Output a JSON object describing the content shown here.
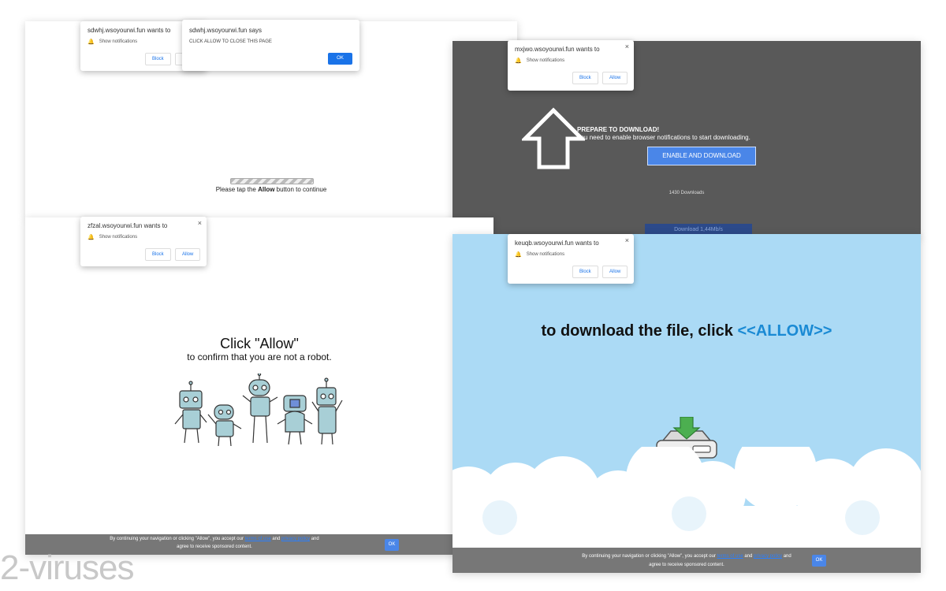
{
  "panel1": {
    "notification": {
      "title": "sdwhj.wsoyourwi.fun wants to",
      "permission": "Show notifications",
      "block": "Block",
      "allow": "A"
    },
    "dialog": {
      "title": "sdwhj.wsoyourwi.fun says",
      "message": "CLICK ALLOW TO CLOSE THIS PAGE",
      "ok": "OK"
    },
    "tap_pre": "Please tap the ",
    "tap_bold": "Allow",
    "tap_post": " button to continue"
  },
  "panel2": {
    "notification": {
      "title": "mxjwo.wsoyourwi.fun wants to",
      "permission": "Show notifications",
      "block": "Block",
      "allow": "Allow",
      "close": "×"
    },
    "prepare": "PREPARE TO DOWNLOAD!",
    "need": "You need to enable browser notifications to start downloading.",
    "enable_button": "ENABLE AND DOWNLOAD",
    "downloads": "1430 Downloads",
    "speed": "Download 1,44Mb/s"
  },
  "panel3": {
    "notification": {
      "title": "zfzal.wsoyourwi.fun wants to",
      "permission": "Show notifications",
      "block": "Block",
      "allow": "Allow",
      "close": "×"
    },
    "heading": "Click \"Allow\"",
    "sub": "to confirm that you are not a robot.",
    "cookie": {
      "pre": "By continuing your navigation or clicking \"Allow\", you accept our ",
      "terms": "terms of use",
      "and": " and ",
      "privacy": "privacy policy",
      "post": " and",
      "line2": "agree to receive sponsored content.",
      "ok": "OK"
    }
  },
  "panel4": {
    "notification": {
      "title": "keuqb.wsoyourwi.fun wants to",
      "permission": "Show notifications",
      "block": "Block",
      "allow": "Allow",
      "close": "×"
    },
    "heading_pre": "to download the file, click ",
    "heading_allow": "<<ALLOW>>",
    "cookie": {
      "pre": "By continuing your navigation or clicking \"Allow\", you accept our ",
      "terms": "terms of use",
      "and": " and ",
      "privacy": "privacy policy",
      "post": " and",
      "line2": "agree to receive sponsored content.",
      "ok": "OK"
    }
  },
  "watermark": "2-viruses",
  "colors": {
    "accent": "#1a73e8",
    "dark_panel": "#595959",
    "sky": "#abdaf5",
    "allow_blue": "#1a8ad4"
  }
}
